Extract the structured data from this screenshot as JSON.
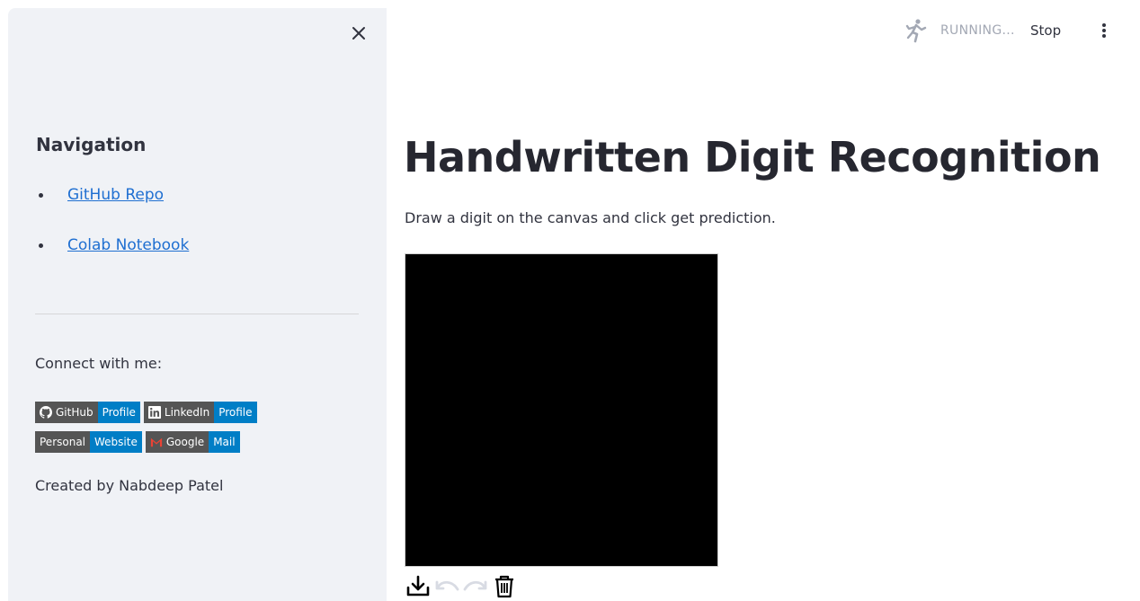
{
  "sidebar": {
    "nav_title": "Navigation",
    "nav_links": [
      "GitHub Repo",
      "Colab Notebook"
    ],
    "connect_text": "Connect with me:",
    "badges": [
      {
        "left": "GitHub",
        "right": "Profile",
        "icon": "github-icon"
      },
      {
        "left": "LinkedIn",
        "right": "Profile",
        "icon": "linkedin-icon"
      },
      {
        "left": "Personal",
        "right": "Website",
        "icon": ""
      },
      {
        "left": "Google",
        "right": "Mail",
        "icon": "gmail-icon"
      }
    ],
    "created_by": "Created by Nabdeep Patel"
  },
  "topbar": {
    "status": "RUNNING...",
    "stop_label": "Stop"
  },
  "main": {
    "title": "Handwritten Digit Recognition",
    "description": "Draw a digit on the canvas and click get prediction."
  },
  "colors": {
    "sidebar_bg": "#f0f2f6",
    "link": "#1f6fd1",
    "badge_left": "#555555",
    "badge_right": "#007ec6",
    "canvas_bg": "#000000"
  }
}
